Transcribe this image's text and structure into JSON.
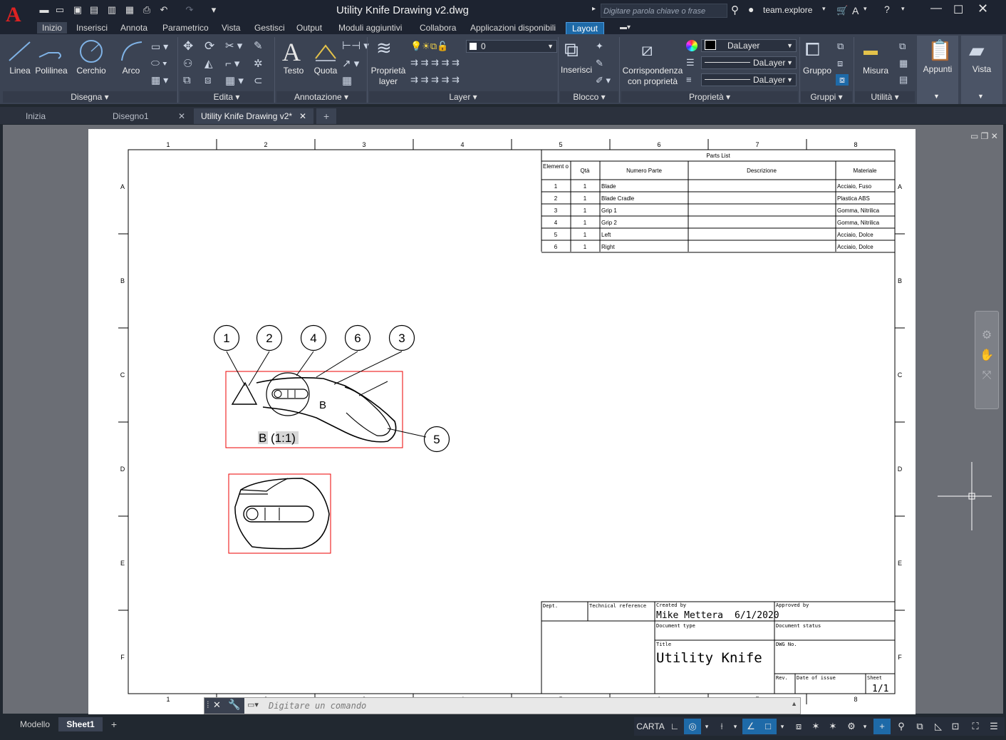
{
  "app": {
    "logo": "A",
    "title": "Utility Knife Drawing v2.dwg"
  },
  "search": {
    "placeholder": "Digitare parola chiave o frase"
  },
  "user": {
    "name": "team.explore"
  },
  "menu_tabs": [
    "Inizio",
    "Inserisci",
    "Annota",
    "Parametrico",
    "Vista",
    "Gestisci",
    "Output",
    "Moduli aggiuntivi",
    "Collabora",
    "Applicazioni disponibili",
    "Layout"
  ],
  "ribbon": {
    "draw": {
      "linea": "Linea",
      "polilinea": "Polilinea",
      "cerchio": "Cerchio",
      "arco": "Arco",
      "title": "Disegna ▾"
    },
    "modify": {
      "title": "Edita ▾"
    },
    "annotation": {
      "testo": "Testo",
      "quota": "Quota",
      "title": "Annotazione ▾"
    },
    "layers": {
      "proprieta_1": "Proprietà",
      "proprieta_2": "layer",
      "current_layer": "0",
      "title": "Layer ▾"
    },
    "block": {
      "inserisci": "Inserisci",
      "title": "Blocco ▾"
    },
    "match": {
      "line1": "Corrispondenza",
      "line2": "con proprietà"
    },
    "properties": {
      "color": "DaLayer",
      "linetype": "DaLayer",
      "lineweight": "DaLayer",
      "title": "Proprietà ▾"
    },
    "groups": {
      "gruppo": "Gruppo",
      "title": "Gruppi ▾"
    },
    "utilities": {
      "misura": "Misura",
      "title": "Utilità ▾"
    },
    "clipboard": {
      "appunti": "Appunti"
    },
    "view": {
      "vista": "Vista"
    }
  },
  "file_tabs": [
    "Inizia",
    "Disegno1",
    "Utility Knife Drawing v2*"
  ],
  "sheet": {
    "col_numbers": [
      "1",
      "2",
      "3",
      "4",
      "5",
      "6",
      "7",
      "8"
    ],
    "row_letters": [
      "A",
      "B",
      "C",
      "D",
      "E",
      "F"
    ],
    "parts_list": {
      "title": "Parts List",
      "headers": [
        "Element o",
        "Qtà",
        "Numero Parte",
        "Descrizione",
        "Materiale"
      ],
      "rows": [
        [
          "1",
          "1",
          "Blade",
          "",
          "Acciaio, Fuso"
        ],
        [
          "2",
          "1",
          "Blade Cradle",
          "",
          "Plastica ABS"
        ],
        [
          "3",
          "1",
          "Grip 1",
          "",
          "Gomma, Nitrilica"
        ],
        [
          "4",
          "1",
          "Grip 2",
          "",
          "Gomma, Nitrilica"
        ],
        [
          "5",
          "1",
          "Left",
          "",
          "Acciaio, Dolce"
        ],
        [
          "6",
          "1",
          "Right",
          "",
          "Acciaio, Dolce"
        ]
      ]
    },
    "balloons": [
      "1",
      "2",
      "4",
      "6",
      "3",
      "5"
    ],
    "detail_marker": "B",
    "view_label_letter": "B",
    "view_label_scale": "(1:1)",
    "title_block": {
      "dept": "Dept.",
      "tech_ref": "Technical reference",
      "created_by_label": "Created by",
      "created_by": "Mike Mettera",
      "date": "6/1/2020",
      "approved_by": "Approved by",
      "doc_type": "Document type",
      "doc_status": "Document status",
      "title_label": "Title",
      "title": "Utility Knife",
      "dwg_no": "DWG No.",
      "rev": "Rev.",
      "date_of_issue": "Date of issue",
      "sheet_label": "Sheet",
      "sheet_value": "1/1"
    }
  },
  "command": {
    "placeholder": "Digitare un comando"
  },
  "layout_tabs": [
    "Modello",
    "Sheet1"
  ],
  "status": {
    "carta": "CARTA"
  }
}
